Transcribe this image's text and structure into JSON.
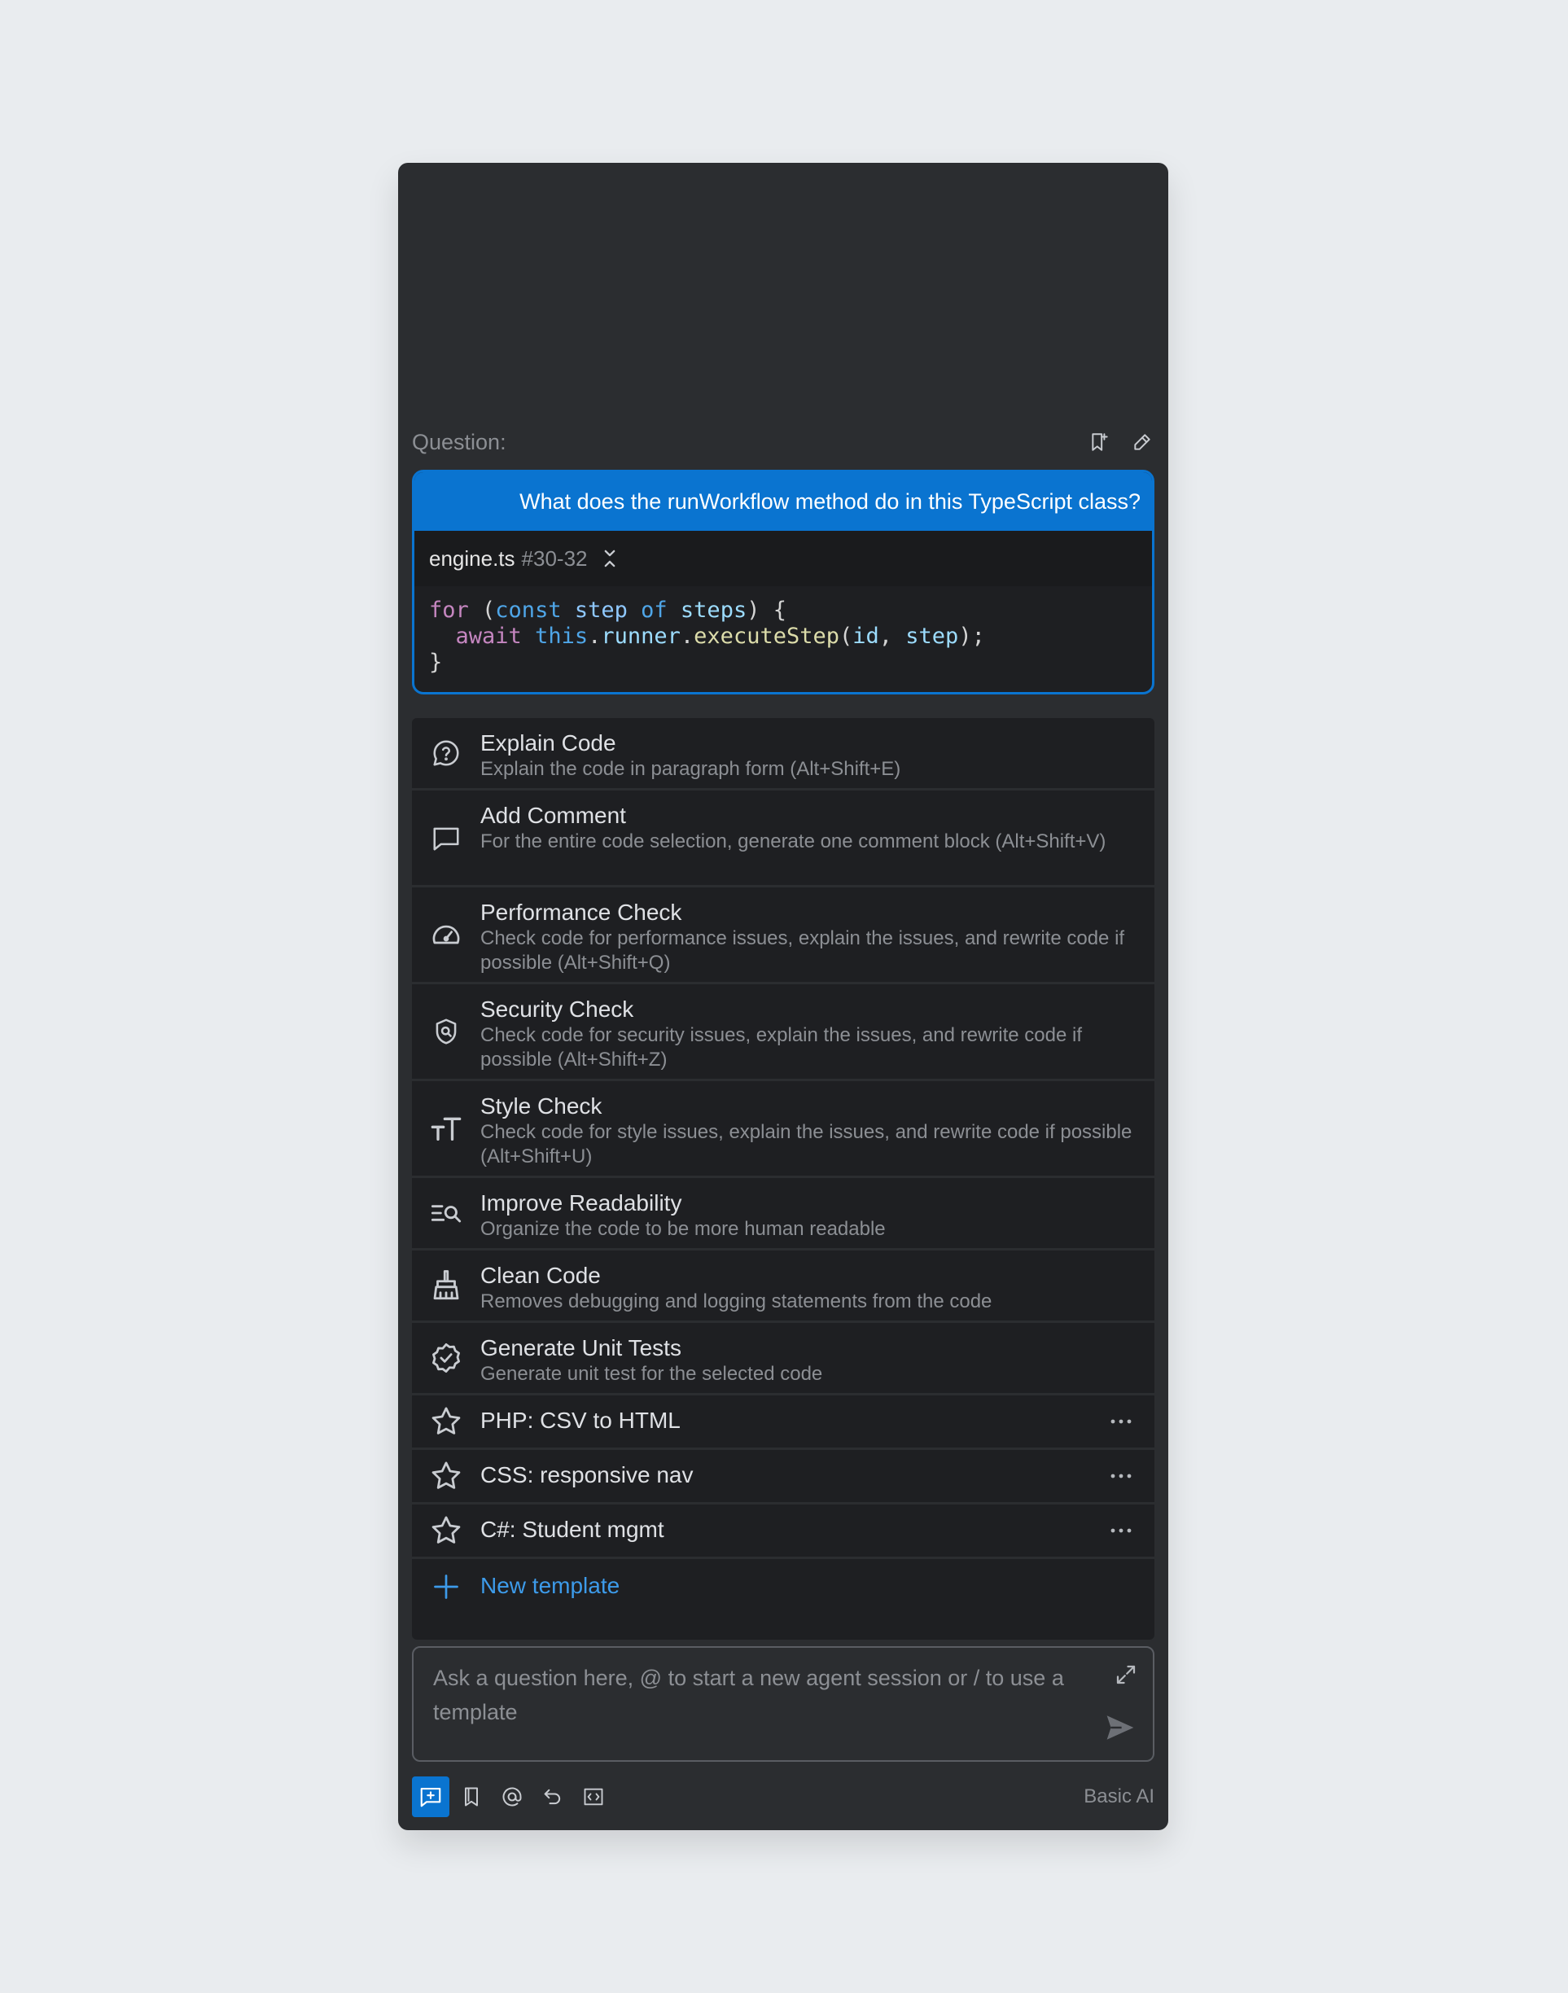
{
  "question_header": {
    "label": "Question:"
  },
  "question": {
    "text": "What does the runWorkflow method do in this TypeScript class?",
    "file_name": "engine.ts",
    "line_range": "#30-32"
  },
  "templates": [
    {
      "icon": "question-circle-icon",
      "title": "Explain Code",
      "description": "Explain the code in paragraph form (Alt+Shift+E)"
    },
    {
      "icon": "comment-icon",
      "title": "Add Comment",
      "description": "For the entire code selection, generate one comment block (Alt+Shift+V)"
    },
    {
      "icon": "speedometer-icon",
      "title": "Performance Check",
      "description": "Check code for performance issues, explain the issues, and rewrite code if possible (Alt+Shift+Q)"
    },
    {
      "icon": "shield-search-icon",
      "title": "Security Check",
      "description": "Check code for security issues, explain the issues, and rewrite code if possible (Alt+Shift+Z)"
    },
    {
      "icon": "text-size-icon",
      "title": "Style Check",
      "description": "Check code for style issues, explain the issues, and rewrite code if possible (Alt+Shift+U)"
    },
    {
      "icon": "list-search-icon",
      "title": "Improve Readability",
      "description": "Organize the code to be more human readable"
    },
    {
      "icon": "broom-icon",
      "title": "Clean Code",
      "description": "Removes debugging and logging statements from the code"
    },
    {
      "icon": "badge-check-icon",
      "title": "Generate Unit Tests",
      "description": "Generate unit test for the selected code"
    }
  ],
  "custom_templates": [
    {
      "icon": "star-icon",
      "title": "PHP: CSV to HTML"
    },
    {
      "icon": "star-icon",
      "title": "CSS: responsive nav"
    },
    {
      "icon": "star-icon",
      "title": "C#: Student mgmt"
    }
  ],
  "new_template": {
    "icon": "plus-icon",
    "label": "New template"
  },
  "input": {
    "placeholder": "Ask a question here, @ to start a new agent session or / to use a template"
  },
  "toolbar": {
    "model_label": "Basic AI"
  },
  "colors": {
    "accent": "#0a74d0",
    "panel_bg": "#2b2d30",
    "list_bg": "#1e1f22",
    "link": "#3d9bea"
  }
}
